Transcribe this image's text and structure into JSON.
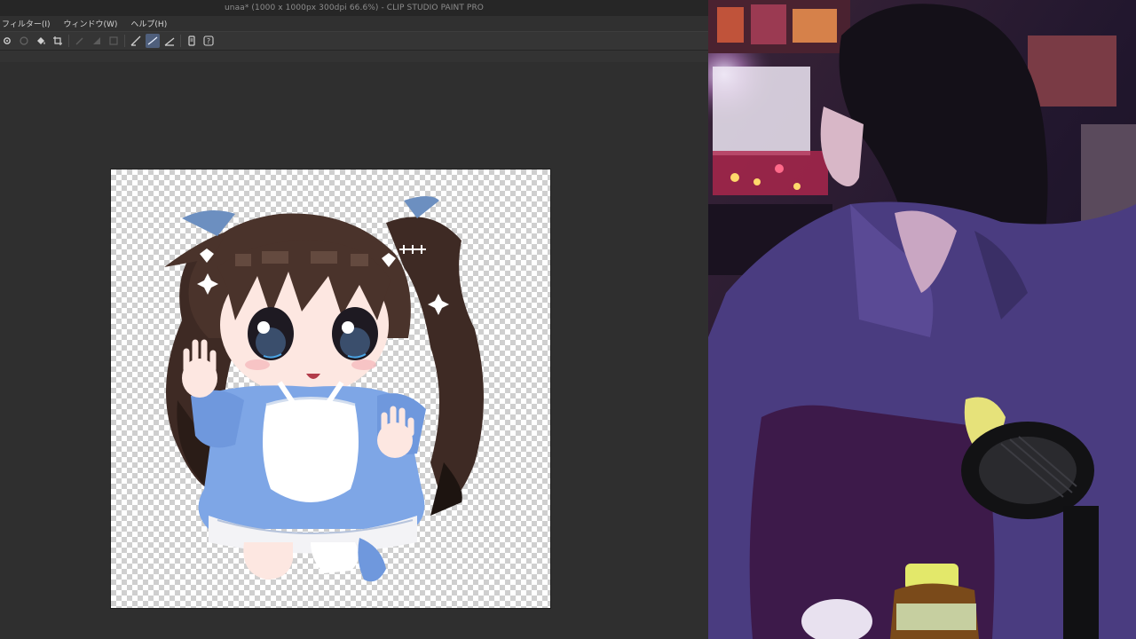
{
  "window": {
    "title": "unaa* (1000 x 1000px 300dpi 66.6%)  - CLIP STUDIO PAINT PRO"
  },
  "menu": {
    "items": [
      {
        "label": "フィルター(I)"
      },
      {
        "label": "ウィンドウ(W)"
      },
      {
        "label": "ヘルプ(H)"
      }
    ]
  },
  "toolbar": {
    "icons": [
      "gear-icon",
      "circle-icon",
      "fill-icon",
      "crop-icon",
      "pen-icon",
      "layer-icon",
      "border-icon",
      "line-icon",
      "line-active-icon",
      "line-alt-icon",
      "device-icon",
      "help-icon"
    ],
    "active_color": "#4f5f7c"
  },
  "canvas": {
    "subject": "chibi maid character illustration"
  },
  "colors": {
    "app_bg": "#2e2e2e",
    "accent": "#4f5f7c",
    "dress_blue": "#7ea6e6",
    "hair_brown": "#3e2a24"
  }
}
